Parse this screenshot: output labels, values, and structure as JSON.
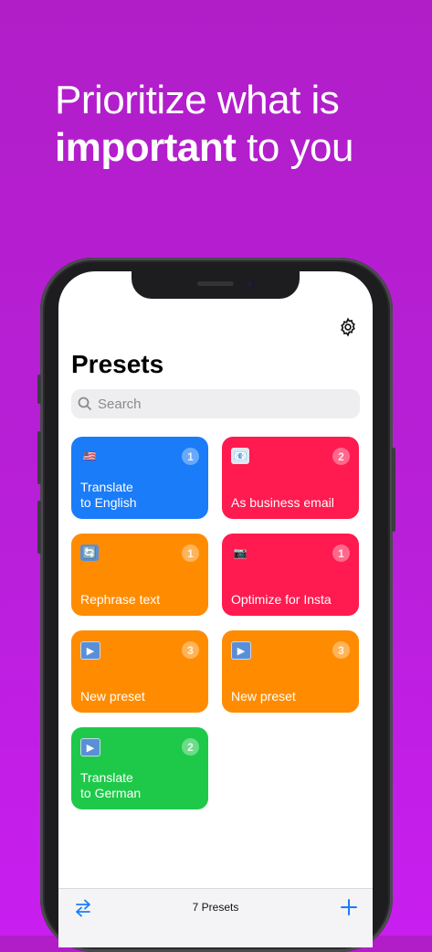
{
  "headline": {
    "line1": "Prioritize what is",
    "line2_bold": "important",
    "line2_rest": " to you"
  },
  "screen": {
    "title": "Presets",
    "search": {
      "placeholder": "Search"
    },
    "presets": [
      {
        "label": "Translate\nto English",
        "count": "1",
        "emoji": "🇺🇸",
        "color": "#1a7cf8",
        "icon": "us-flag-icon"
      },
      {
        "label": "As business email",
        "count": "2",
        "emoji": "📧",
        "color": "#ff1a4f",
        "icon": "email-icon"
      },
      {
        "label": "Rephrase text",
        "count": "1",
        "emoji": "🔄",
        "color": "#ff8c00",
        "icon": "refresh-icon"
      },
      {
        "label": "Optimize for Insta",
        "count": "1",
        "emoji": "📷",
        "color": "#ff1a4f",
        "icon": "camera-icon"
      },
      {
        "label": "New preset",
        "count": "3",
        "emoji": "▶",
        "color": "#ff8c00",
        "icon": "play-icon"
      },
      {
        "label": "New preset",
        "count": "3",
        "emoji": "▶",
        "color": "#ff8c00",
        "icon": "play-icon"
      },
      {
        "label": "Translate\nto German",
        "count": "2",
        "emoji": "▶",
        "color": "#1ec94a",
        "icon": "play-icon"
      }
    ],
    "toolbar": {
      "count_label": "7 Presets"
    },
    "accent": "#1a7cf8"
  }
}
